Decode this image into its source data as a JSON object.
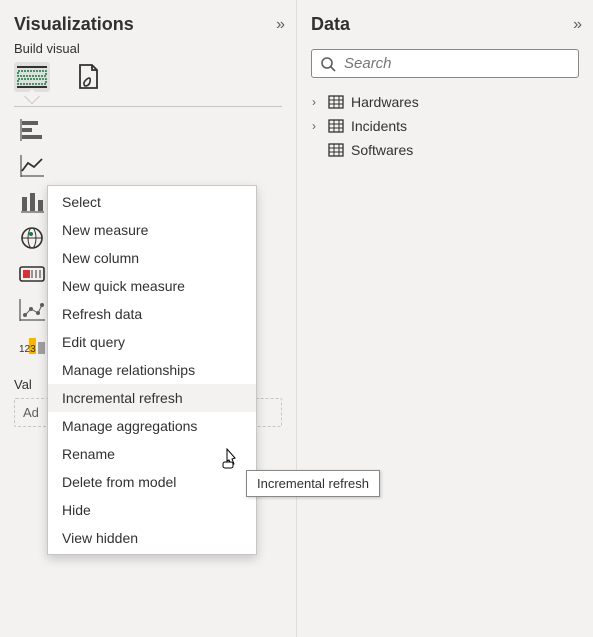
{
  "viz_pane": {
    "title": "Visualizations",
    "collapse_glyph": "»",
    "subtitle": "Build visual",
    "values_label": "Val",
    "add_placeholder": "Ad"
  },
  "data_pane": {
    "title": "Data",
    "collapse_glyph": "»",
    "search_placeholder": "Search",
    "tables": [
      {
        "name": "Hardwares",
        "expanded": false,
        "chevron": "›"
      },
      {
        "name": "Incidents",
        "expanded": false,
        "chevron": "›"
      },
      {
        "name": "Softwares",
        "expanded": false,
        "chevron": ""
      }
    ]
  },
  "context_menu": {
    "items": [
      {
        "label": "Select",
        "hover": false
      },
      {
        "label": "New measure",
        "hover": false
      },
      {
        "label": "New column",
        "hover": false
      },
      {
        "label": "New quick measure",
        "hover": false
      },
      {
        "label": "Refresh data",
        "hover": false
      },
      {
        "label": "Edit query",
        "hover": false
      },
      {
        "label": "Manage relationships",
        "hover": false
      },
      {
        "label": "Incremental refresh",
        "hover": true
      },
      {
        "label": "Manage aggregations",
        "hover": false
      },
      {
        "label": "Rename",
        "hover": false
      },
      {
        "label": "Delete from model",
        "hover": false
      },
      {
        "label": "Hide",
        "hover": false
      },
      {
        "label": "View hidden",
        "hover": false
      }
    ]
  },
  "tooltip_text": "Incremental refresh"
}
